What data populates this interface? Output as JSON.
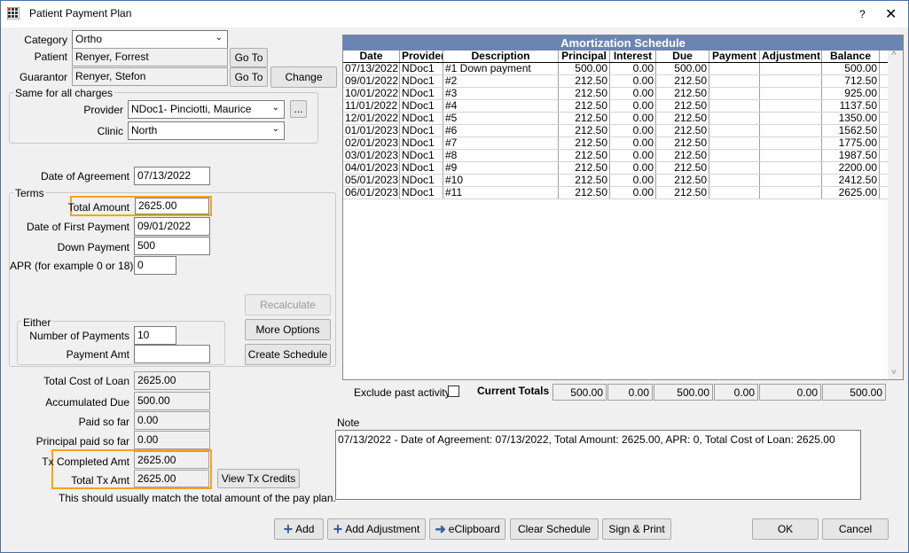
{
  "window": {
    "title": "Patient Payment Plan",
    "help": "?",
    "close": "✕"
  },
  "category": {
    "label": "Category",
    "value": "Ortho"
  },
  "patient": {
    "label": "Patient",
    "value": "Renyer, Forrest",
    "goto": "Go To"
  },
  "guarantor": {
    "label": "Guarantor",
    "value": "Renyer, Stefon",
    "goto": "Go To",
    "change": "Change"
  },
  "same_all": {
    "title": "Same for all charges",
    "provider_label": "Provider",
    "provider_value": "NDoc1- Pinciotti, Maurice",
    "provider_pick": "...",
    "clinic_label": "Clinic",
    "clinic_value": "North"
  },
  "date_of_agreement": {
    "label": "Date of Agreement",
    "value": "07/13/2022"
  },
  "terms": {
    "title": "Terms",
    "total_amount_label": "Total Amount",
    "total_amount": "2625.00",
    "first_payment_label": "Date of First Payment",
    "first_payment": "09/01/2022",
    "down_payment_label": "Down Payment",
    "down_payment": "500",
    "apr_label": "APR (for example 0 or 18)",
    "apr": "0",
    "recalculate": "Recalculate",
    "more_options": "More Options",
    "create_schedule": "Create Schedule",
    "either_title": "Either",
    "num_payments_label": "Number of Payments",
    "num_payments": "10",
    "payment_amt_label": "Payment Amt",
    "payment_amt": ""
  },
  "summary": {
    "total_cost_label": "Total Cost of Loan",
    "total_cost": "2625.00",
    "accum_due_label": "Accumulated Due",
    "accum_due": "500.00",
    "paid_label": "Paid so far",
    "paid": "0.00",
    "principal_paid_label": "Principal paid so far",
    "principal_paid": "0.00",
    "tx_completed_label": "Tx Completed Amt",
    "tx_completed": "2625.00",
    "total_tx_label": "Total Tx Amt",
    "total_tx": "2625.00",
    "view_credits": "View Tx Credits",
    "note": "This should usually match the total amount of the pay plan."
  },
  "schedule": {
    "title": "Amortization Schedule",
    "columns": [
      "Date",
      "Provider",
      "Description",
      "Principal",
      "Interest",
      "Due",
      "Payment",
      "Adjustment",
      "Balance"
    ],
    "rows": [
      [
        "07/13/2022",
        "NDoc1",
        "#1 Down payment",
        "500.00",
        "0.00",
        "500.00",
        "",
        "",
        "500.00"
      ],
      [
        "09/01/2022",
        "NDoc1",
        "#2",
        "212.50",
        "0.00",
        "212.50",
        "",
        "",
        "712.50"
      ],
      [
        "10/01/2022",
        "NDoc1",
        "#3",
        "212.50",
        "0.00",
        "212.50",
        "",
        "",
        "925.00"
      ],
      [
        "11/01/2022",
        "NDoc1",
        "#4",
        "212.50",
        "0.00",
        "212.50",
        "",
        "",
        "1137.50"
      ],
      [
        "12/01/2022",
        "NDoc1",
        "#5",
        "212.50",
        "0.00",
        "212.50",
        "",
        "",
        "1350.00"
      ],
      [
        "01/01/2023",
        "NDoc1",
        "#6",
        "212.50",
        "0.00",
        "212.50",
        "",
        "",
        "1562.50"
      ],
      [
        "02/01/2023",
        "NDoc1",
        "#7",
        "212.50",
        "0.00",
        "212.50",
        "",
        "",
        "1775.00"
      ],
      [
        "03/01/2023",
        "NDoc1",
        "#8",
        "212.50",
        "0.00",
        "212.50",
        "",
        "",
        "1987.50"
      ],
      [
        "04/01/2023",
        "NDoc1",
        "#9",
        "212.50",
        "0.00",
        "212.50",
        "",
        "",
        "2200.00"
      ],
      [
        "05/01/2023",
        "NDoc1",
        "#10",
        "212.50",
        "0.00",
        "212.50",
        "",
        "",
        "2412.50"
      ],
      [
        "06/01/2023",
        "NDoc1",
        "#11",
        "212.50",
        "0.00",
        "212.50",
        "",
        "",
        "2625.00"
      ]
    ]
  },
  "exclude_past": {
    "label": "Exclude past activity",
    "checked": false
  },
  "totals": {
    "label": "Current Totals",
    "principal": "500.00",
    "interest": "0.00",
    "due": "500.00",
    "payment": "0.00",
    "adjustment": "0.00",
    "balance": "500.00"
  },
  "note": {
    "label": "Note",
    "text": "07/13/2022 - Date of Agreement: 07/13/2022, Total Amount: 2625.00, APR: 0, Total Cost of Loan: 2625.00"
  },
  "footer": {
    "add": "Add",
    "add_adjustment": "Add Adjustment",
    "eclipboard": "eClipboard",
    "clear_schedule": "Clear Schedule",
    "sign_print": "Sign & Print",
    "ok": "OK",
    "cancel": "Cancel"
  },
  "colors": {
    "grid_header": "#6a85b3",
    "highlight": "#f4a31c",
    "add_icon": "#3a5f9c"
  }
}
